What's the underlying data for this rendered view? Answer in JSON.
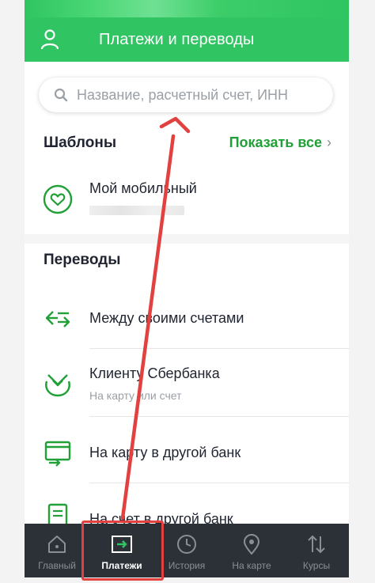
{
  "header": {
    "title": "Платежи и переводы"
  },
  "search": {
    "placeholder": "Название, расчетный счет, ИНН"
  },
  "templates": {
    "section_title": "Шаблоны",
    "show_all": "Показать все",
    "items": [
      {
        "label": "Мой мобильный"
      }
    ]
  },
  "transfers": {
    "section_title": "Переводы",
    "items": [
      {
        "label": "Между своими счетами",
        "subtitle": ""
      },
      {
        "label": "Клиенту Сбербанка",
        "subtitle": "На карту или счет"
      },
      {
        "label": "На карту в другой банк",
        "subtitle": ""
      },
      {
        "label": "На счет в другой банк",
        "subtitle": ""
      }
    ]
  },
  "tabbar": {
    "tabs": [
      {
        "label": "Главный",
        "icon": "home-icon"
      },
      {
        "label": "Платежи",
        "icon": "payments-icon",
        "active": true
      },
      {
        "label": "История",
        "icon": "clock-icon"
      },
      {
        "label": "На карте",
        "icon": "map-pin-icon"
      },
      {
        "label": "Курсы",
        "icon": "exchange-arrows-icon"
      }
    ]
  },
  "colors": {
    "brand_green": "#30c463",
    "link_green": "#21a038",
    "tabbar_bg": "#2c3138",
    "annotation_red": "#e2413f"
  }
}
